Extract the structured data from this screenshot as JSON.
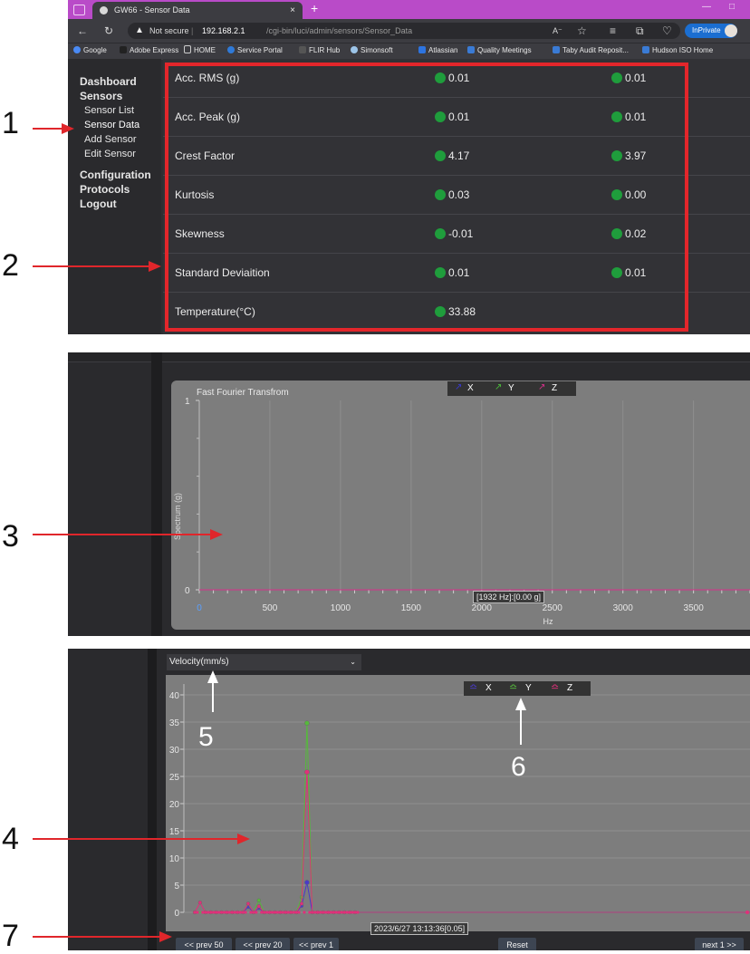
{
  "browser": {
    "tab_title": "GW66 - Sensor Data",
    "tab_close": "×",
    "new_tab": "+",
    "not_secure": "Not secure",
    "url_host": "192.168.2.1",
    "url_path": "/cgi-bin/luci/admin/sensors/Sensor_Data",
    "inprivate": "InPrivate",
    "bookmarks": [
      "Google",
      "Adobe Express",
      "HOME",
      "Service Portal",
      "FLIR Hub",
      "Simonsoft",
      "Atlassian",
      "Quality Meetings",
      "Taby Audit Reposit...",
      "Hudson ISO Home"
    ],
    "accent": "#b94bc8"
  },
  "sidebar": {
    "dashboard": "Dashboard",
    "sensors": "Sensors",
    "sensor_list": "Sensor List",
    "sensor_data": "Sensor Data",
    "add_sensor": "Add Sensor",
    "edit_sensor": "Edit Sensor",
    "configuration": "Configuration",
    "protocols": "Protocols",
    "logout": "Logout"
  },
  "table": {
    "rows": [
      {
        "label": "Acc. RMS (g)",
        "v1": "0.01",
        "v2": "0.01"
      },
      {
        "label": "Acc. Peak (g)",
        "v1": "0.01",
        "v2": "0.01"
      },
      {
        "label": "Crest Factor",
        "v1": "4.17",
        "v2": "3.97"
      },
      {
        "label": "Kurtosis",
        "v1": "0.03",
        "v2": "0.00"
      },
      {
        "label": "Skewness",
        "v1": "-0.01",
        "v2": "0.02"
      },
      {
        "label": "Standard Deviaition",
        "v1": "0.01",
        "v2": "0.01"
      },
      {
        "label": "Temperature(°C)",
        "v1": "33.88",
        "v2": ""
      }
    ],
    "status_color": "#1f9d3c"
  },
  "annotations": {
    "n1": "1",
    "n2": "2",
    "n3": "3",
    "n4": "4",
    "n5": "5",
    "n6": "6",
    "n7": "7",
    "color": "#e0262b"
  },
  "fft": {
    "title": "Fast Fourier Transfrom",
    "legend": {
      "x": "X",
      "y": "Y",
      "z": "Z"
    },
    "ylabel": "Spectrum (g)",
    "xlabel": "Hz",
    "tooltip": "[1932 Hz]:[0.00 g]"
  },
  "velocity": {
    "selected_metric": "Velocity(mm/s)",
    "legend": {
      "x": "X",
      "y": "Y",
      "z": "Z"
    },
    "tooltip": "2023/6/27 13:13:36[0.05]",
    "buttons": {
      "prev50": "<< prev 50",
      "prev20": "<< prev 20",
      "prev1": "<< prev 1",
      "reset": "Reset",
      "next1": "next 1 >>"
    }
  },
  "chart_data": [
    {
      "type": "line",
      "title": "Fast Fourier Transfrom",
      "xlabel": "Hz",
      "ylabel": "Spectrum (g)",
      "x_ticks": [
        "0",
        "500",
        "1000",
        "1500",
        "2000",
        "2500",
        "3000",
        "3500"
      ],
      "y_ticks": [
        "0",
        "1"
      ],
      "xlim": [
        0,
        3900
      ],
      "ylim": [
        0,
        1
      ],
      "series": [
        {
          "name": "X",
          "color": "#3a3ad0",
          "x": [
            0,
            3900
          ],
          "y": [
            0,
            0
          ]
        },
        {
          "name": "Y",
          "color": "#4bbf3a",
          "x": [
            0,
            3900
          ],
          "y": [
            0,
            0
          ]
        },
        {
          "name": "Z",
          "color": "#d6308a",
          "x": [
            0,
            3900
          ],
          "y": [
            0,
            0
          ]
        }
      ],
      "legend": "top-center",
      "grid": true
    },
    {
      "type": "line",
      "title": "",
      "ylabel": "Velocity(mm/s)",
      "y_ticks": [
        "0",
        "5",
        "10",
        "15",
        "20",
        "25",
        "30",
        "35",
        "40"
      ],
      "ylim": [
        0,
        42
      ],
      "series": [
        {
          "name": "X",
          "color": "#4a3ac8",
          "x": [
            0,
            1,
            2,
            3,
            4,
            5,
            6,
            7,
            8,
            9,
            10,
            11,
            12,
            13,
            14,
            15,
            16,
            17,
            18,
            19,
            20,
            21,
            22,
            23,
            24,
            25,
            26,
            27,
            28,
            29,
            30
          ],
          "y": [
            0,
            0,
            0,
            0,
            0,
            0,
            0,
            0,
            0,
            0,
            1,
            0,
            0.8,
            0,
            0,
            0,
            0,
            0,
            0,
            0,
            1.2,
            5.5,
            0,
            0,
            0,
            0,
            0,
            0,
            0,
            0,
            0
          ]
        },
        {
          "name": "Y",
          "color": "#56b93c",
          "x": [
            0,
            1,
            2,
            3,
            4,
            5,
            6,
            7,
            8,
            9,
            10,
            11,
            12,
            13,
            14,
            15,
            16,
            17,
            18,
            19,
            20,
            21,
            22,
            23,
            24,
            25,
            26,
            27,
            28,
            29,
            30
          ],
          "y": [
            0,
            0,
            0,
            0,
            0,
            0,
            0,
            0,
            0,
            0,
            1.5,
            0,
            2.2,
            0,
            0,
            0,
            0,
            0,
            0,
            0,
            2.8,
            34.8,
            0,
            0,
            0,
            0,
            0,
            0,
            0,
            0,
            0
          ]
        },
        {
          "name": "Z",
          "color": "#e0307a",
          "x": [
            0,
            1,
            2,
            3,
            4,
            5,
            6,
            7,
            8,
            9,
            10,
            11,
            12,
            13,
            14,
            15,
            16,
            17,
            18,
            19,
            20,
            21,
            22,
            23,
            24,
            25,
            26,
            27,
            28,
            29,
            30
          ],
          "y": [
            0,
            1.8,
            0,
            0,
            0,
            0,
            0,
            0,
            0,
            0,
            1.6,
            0,
            1.1,
            0,
            0,
            0,
            0,
            0,
            0,
            0,
            1.6,
            25.8,
            0,
            0,
            0,
            0,
            0,
            0,
            0,
            0,
            0
          ]
        }
      ],
      "legend": "top-center",
      "grid": true
    }
  ]
}
